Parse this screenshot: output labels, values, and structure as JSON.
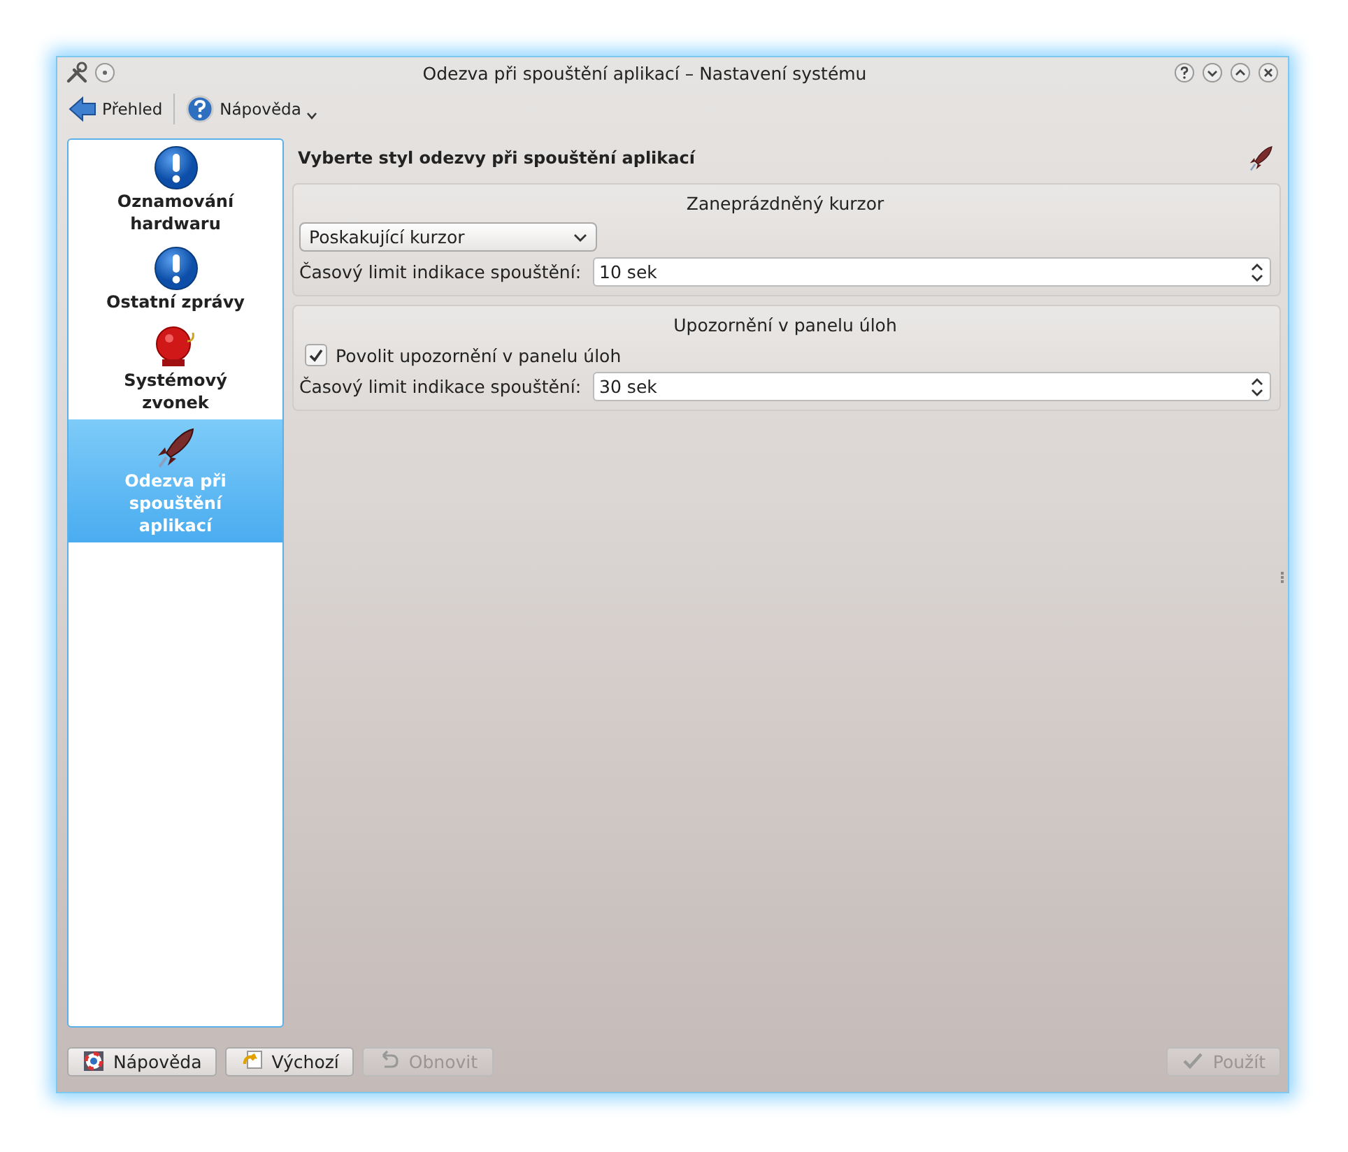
{
  "window": {
    "title": "Odezva při spouštění aplikací – Nastavení systému"
  },
  "toolbar": [
    {
      "kind": "back",
      "label": "Přehled"
    },
    {
      "kind": "help",
      "label": "Nápověda",
      "dropdown": true
    }
  ],
  "sidebar": {
    "items": [
      {
        "kind": "info",
        "label": "Oznamování hardwaru",
        "selected": false
      },
      {
        "kind": "info",
        "label": "Ostatní zprávy",
        "selected": false
      },
      {
        "kind": "bell",
        "label": "Systémový zvonek",
        "selected": false
      },
      {
        "kind": "rocket",
        "label": "Odezva při spouštění aplikací",
        "selected": true
      }
    ]
  },
  "heading": "Vyberte styl odezvy při spouštění aplikací",
  "groups": [
    {
      "title": "Zaneprázdněný kurzor",
      "rows": [
        {
          "kind": "combo",
          "value": "Poskakující kurzor"
        },
        {
          "kind": "spin",
          "label": "Časový limit indikace spouštění:",
          "value": "10 sek"
        }
      ]
    },
    {
      "title": "Upozornění v panelu úloh",
      "rows": [
        {
          "kind": "check",
          "label": "Povolit upozornění v panelu úloh",
          "checked": true
        },
        {
          "kind": "spin",
          "label": "Časový limit indikace spouštění:",
          "value": "30 sek"
        }
      ]
    }
  ],
  "buttons": [
    {
      "kind": "help",
      "label": "Nápověda",
      "disabled": false
    },
    {
      "kind": "defaults",
      "label": "Výchozí",
      "disabled": false
    },
    {
      "kind": "reset",
      "label": "Obnovit",
      "disabled": true
    },
    {
      "kind": "apply",
      "label": "Použít",
      "disabled": true
    }
  ]
}
